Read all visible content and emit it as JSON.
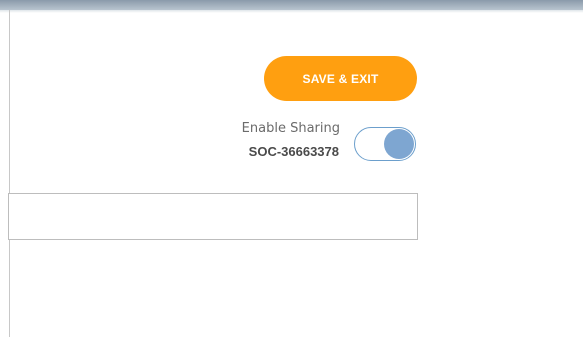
{
  "header": {
    "save_exit_label": "SAVE & EXIT"
  },
  "sharing": {
    "label": "Enable Sharing",
    "id": "SOC-36663378",
    "enabled": true
  },
  "field": {
    "value": ""
  },
  "colors": {
    "accent": "#ff9f10",
    "toggle": "#7ea6d1"
  }
}
